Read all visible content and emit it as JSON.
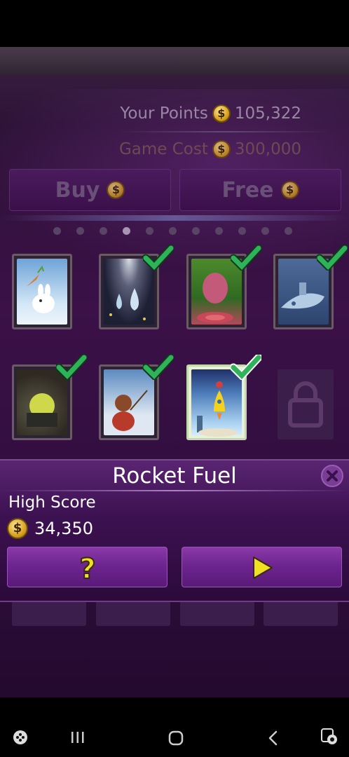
{
  "points": {
    "label": "Your Points",
    "value": "105,322",
    "cost_label": "Game Cost",
    "cost_value": "300,000"
  },
  "buttons": {
    "buy_label": "Buy",
    "free_label": "Free"
  },
  "pager": {
    "count": 11,
    "active_index": 3
  },
  "games": [
    {
      "icon": "rabbit-carrot",
      "completed": false
    },
    {
      "icon": "raindrops",
      "completed": true
    },
    {
      "icon": "radish-target",
      "completed": true
    },
    {
      "icon": "submarine",
      "completed": true
    },
    {
      "icon": "dome-tunnel",
      "completed": true
    },
    {
      "icon": "bear-fishing",
      "completed": true
    },
    {
      "icon": "rocket",
      "completed": true,
      "selected": true
    },
    {
      "icon": "lock",
      "locked": true
    }
  ],
  "dialog": {
    "title": "Rocket Fuel",
    "high_score_label": "High Score",
    "high_score_value": "34,350",
    "help_icon": "question-mark-icon",
    "play_icon": "play-icon"
  },
  "colors": {
    "accent_gold": "#e8d21e",
    "check_green": "#2fb35a",
    "dialog_purple": "#5a2572"
  },
  "coin_glyph": "$"
}
